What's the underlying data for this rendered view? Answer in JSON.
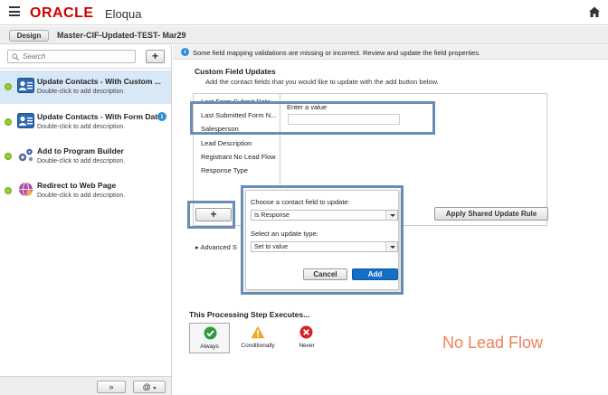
{
  "app": {
    "brand": "ORACLE",
    "product": "Eloqua",
    "menu_icon": "hamburger-menu-icon",
    "home_icon": "home-icon"
  },
  "toolbar": {
    "design_label": "Design",
    "program_name": "Master-CIF-Updated-TEST- Mar29"
  },
  "sidebar": {
    "search_placeholder": "Search",
    "add_label": "+",
    "steps": [
      {
        "title": "Update Contacts - With Custom ...",
        "description": "Double-click to add description.",
        "selected": true,
        "icon": "update-contacts-icon"
      },
      {
        "title": "Update Contacts - With Form Data",
        "description": "Double-click to add description.",
        "selected": false,
        "icon": "update-contacts-icon",
        "has_info": true
      },
      {
        "title": "Add to Program Builder",
        "description": "Double-click to add description.",
        "selected": false,
        "icon": "program-builder-icon"
      },
      {
        "title": "Redirect to Web Page",
        "description": "Double-click to add description.",
        "selected": false,
        "icon": "redirect-web-icon"
      }
    ],
    "bottom_buttons": {
      "expand": "»",
      "at": "@"
    }
  },
  "main": {
    "info_message": "Some field mapping validations are missing or incorrect. Review and update the field properties.",
    "section_title": "Custom Field Updates",
    "section_subtitle": "Add the contact fields that you would like to update with the add button below.",
    "fields": [
      "Last Form Submit Date",
      "Last Submitted Form N...",
      "Salesperson",
      "Lead Description",
      "Registrant No Lead Flow",
      "Response Type"
    ],
    "value_label": "Enter a value",
    "value_input": "",
    "apply_label": "Apply Shared Update Rule",
    "add_rule_label": "+",
    "advanced_label": "Advanced S"
  },
  "popup": {
    "contact_field_label": "Choose a contact field to update:",
    "contact_field_value": "Is Response",
    "update_type_label": "Select an update type:",
    "update_type_value": "Set to value",
    "cancel_label": "Cancel",
    "add_label": "Add"
  },
  "execution": {
    "title": "This Processing Step Executes...",
    "options": [
      {
        "label": "Always",
        "icon": "checkmark-circle-icon",
        "selected": true
      },
      {
        "label": "Conditionally",
        "icon": "warning-triangle-icon",
        "selected": false
      },
      {
        "label": "Never",
        "icon": "x-circle-icon",
        "selected": false
      }
    ]
  },
  "annotation": {
    "text": "No Lead Flow",
    "color": "#f07f5c",
    "highlight_color": "#6b8db5"
  },
  "colors": {
    "brand_red": "#cc0000",
    "selected_step": "#d9e8f7",
    "primary_button": "#1470c6",
    "status_green": "#99cc33"
  }
}
